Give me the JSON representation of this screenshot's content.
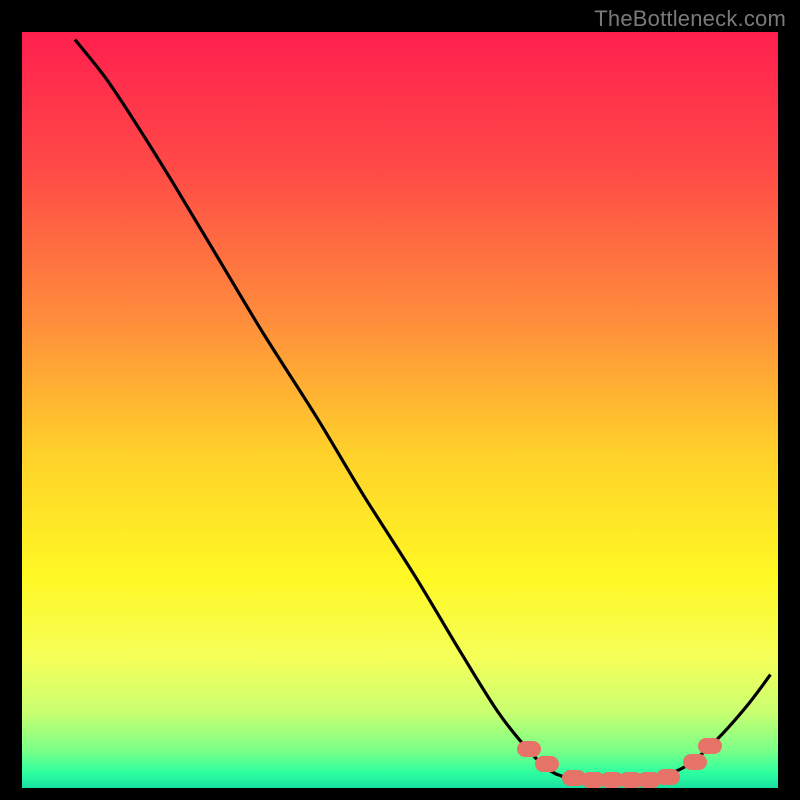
{
  "watermark": "TheBottleneck.com",
  "chart_data": {
    "type": "line",
    "title": "",
    "xlabel": "",
    "ylabel": "",
    "x_range": [
      0,
      100
    ],
    "y_range": [
      0,
      100
    ],
    "curve": [
      {
        "x": 7,
        "y": 99
      },
      {
        "x": 11,
        "y": 94
      },
      {
        "x": 15,
        "y": 88
      },
      {
        "x": 20,
        "y": 80
      },
      {
        "x": 26,
        "y": 70
      },
      {
        "x": 32,
        "y": 60
      },
      {
        "x": 39,
        "y": 49
      },
      {
        "x": 45,
        "y": 39
      },
      {
        "x": 52,
        "y": 28
      },
      {
        "x": 58,
        "y": 18
      },
      {
        "x": 63,
        "y": 10
      },
      {
        "x": 67,
        "y": 5
      },
      {
        "x": 70,
        "y": 2.2
      },
      {
        "x": 73,
        "y": 1.2
      },
      {
        "x": 76,
        "y": 1.0
      },
      {
        "x": 80,
        "y": 1.0
      },
      {
        "x": 84,
        "y": 1.4
      },
      {
        "x": 88,
        "y": 3.0
      },
      {
        "x": 92,
        "y": 6.5
      },
      {
        "x": 96,
        "y": 11
      },
      {
        "x": 99,
        "y": 15
      }
    ],
    "markers": [
      {
        "x": 67,
        "y": 5.2
      },
      {
        "x": 69.5,
        "y": 3.2
      },
      {
        "x": 73,
        "y": 1.3
      },
      {
        "x": 75.5,
        "y": 1.1
      },
      {
        "x": 78,
        "y": 1.0
      },
      {
        "x": 80.5,
        "y": 1.0
      },
      {
        "x": 83,
        "y": 1.1
      },
      {
        "x": 85.5,
        "y": 1.5
      },
      {
        "x": 89,
        "y": 3.5
      },
      {
        "x": 91,
        "y": 5.5
      }
    ],
    "gradient_stops": [
      {
        "pct": 0,
        "color": "#ff1f4e"
      },
      {
        "pct": 18,
        "color": "#ff4a47"
      },
      {
        "pct": 38,
        "color": "#ff8d3c"
      },
      {
        "pct": 56,
        "color": "#ffd22a"
      },
      {
        "pct": 72,
        "color": "#fff824"
      },
      {
        "pct": 83,
        "color": "#f4ff5a"
      },
      {
        "pct": 90,
        "color": "#c9ff71"
      },
      {
        "pct": 95,
        "color": "#7bff87"
      },
      {
        "pct": 98,
        "color": "#2dffa0"
      },
      {
        "pct": 100,
        "color": "#18e09f"
      }
    ]
  }
}
